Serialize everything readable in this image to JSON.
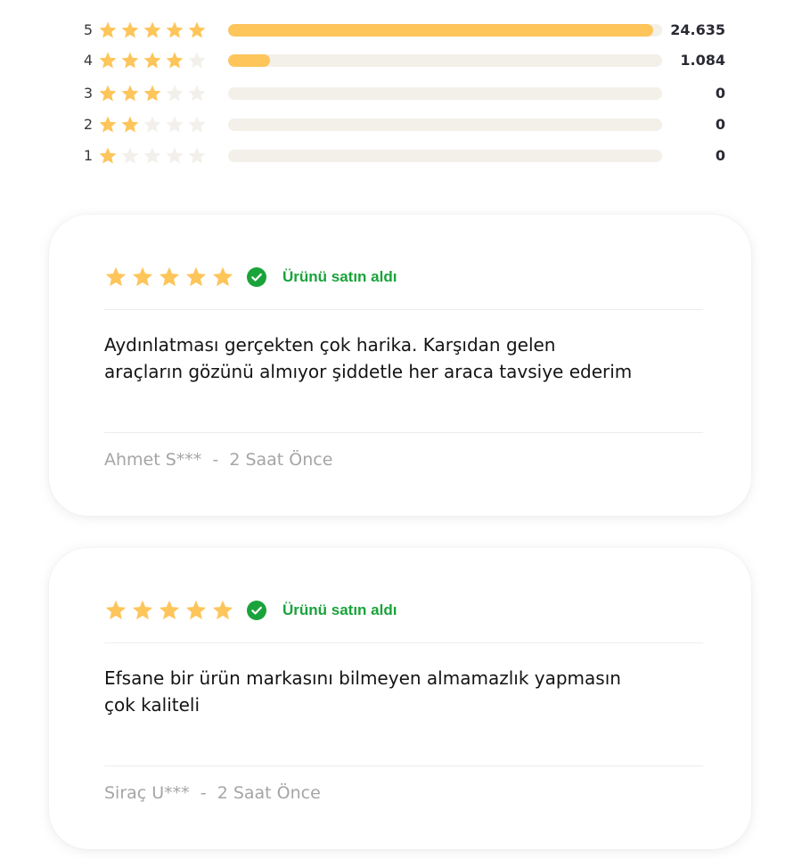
{
  "colors": {
    "star_filled": "#FDC55A",
    "star_empty": "#F3F0EB",
    "bar_track": "#F3EFE9",
    "bar_fill": "#FDC55A",
    "verified_green": "#1AA33A",
    "meta_gray": "#A5A5A5"
  },
  "distribution": [
    {
      "stars_label": "5",
      "filled": 5,
      "count": "24.635",
      "fill_fraction": 0.98
    },
    {
      "stars_label": "4",
      "filled": 4,
      "count": "1.084",
      "fill_fraction": 0.097
    },
    {
      "stars_label": "3",
      "filled": 3,
      "count": "0",
      "fill_fraction": 0
    },
    {
      "stars_label": "2",
      "filled": 2,
      "count": "0",
      "fill_fraction": 0
    },
    {
      "stars_label": "1",
      "filled": 1,
      "count": "0",
      "fill_fraction": 0
    }
  ],
  "reviews": [
    {
      "rating": 5,
      "verified_label": "Ürünü satın aldı",
      "text": "Aydınlatması gerçekten çok harika. Karşıdan gelen araçların gözünü almıyor şiddetle her araca tavsiye ederim",
      "author": "Ahmet S***",
      "separator": "  -  ",
      "time": "2 Saat Önce"
    },
    {
      "rating": 5,
      "verified_label": "Ürünü satın aldı",
      "text": "Efsane bir ürün markasını bilmeyen almamazlık yapmasın çok kaliteli",
      "author": "Siraç U***",
      "separator": "  -  ",
      "time": "2 Saat Önce"
    }
  ],
  "icons": {
    "star": "star-icon",
    "verified": "check-circle-icon"
  }
}
